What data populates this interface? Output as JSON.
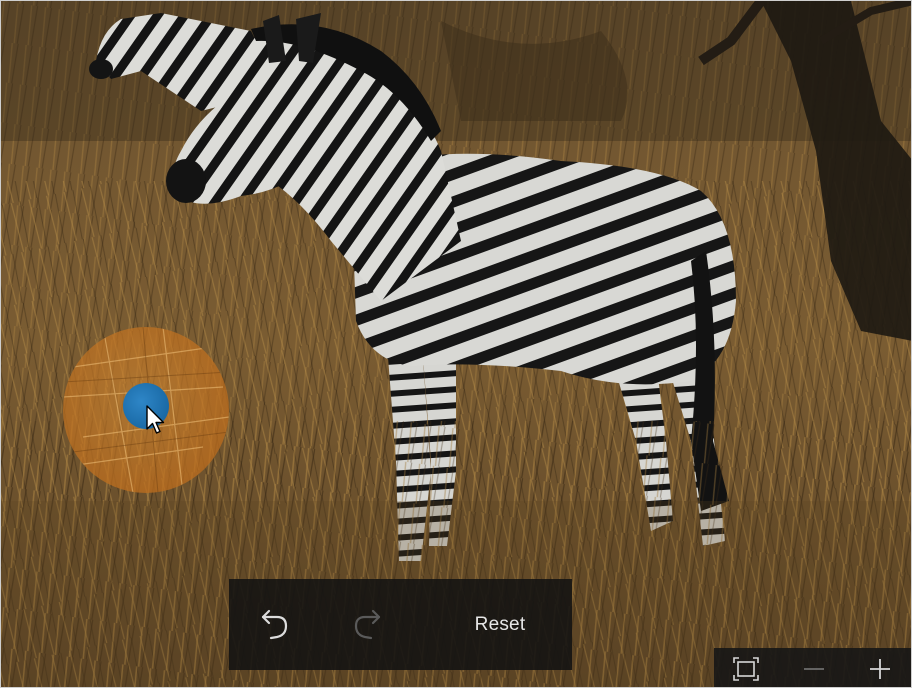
{
  "photo": {
    "subject": "zebra"
  },
  "color_picker": {
    "sampled_color": "#1f75b6",
    "loupe_color": "#c8843a"
  },
  "edit_toolbar": {
    "undo_icon": "undo-icon",
    "redo_icon": "redo-icon",
    "reset_label": "Reset"
  },
  "zoom_bar": {
    "fit_icon": "fit-to-window-icon",
    "zoom_out_icon": "minus-icon",
    "zoom_in_icon": "plus-icon"
  }
}
